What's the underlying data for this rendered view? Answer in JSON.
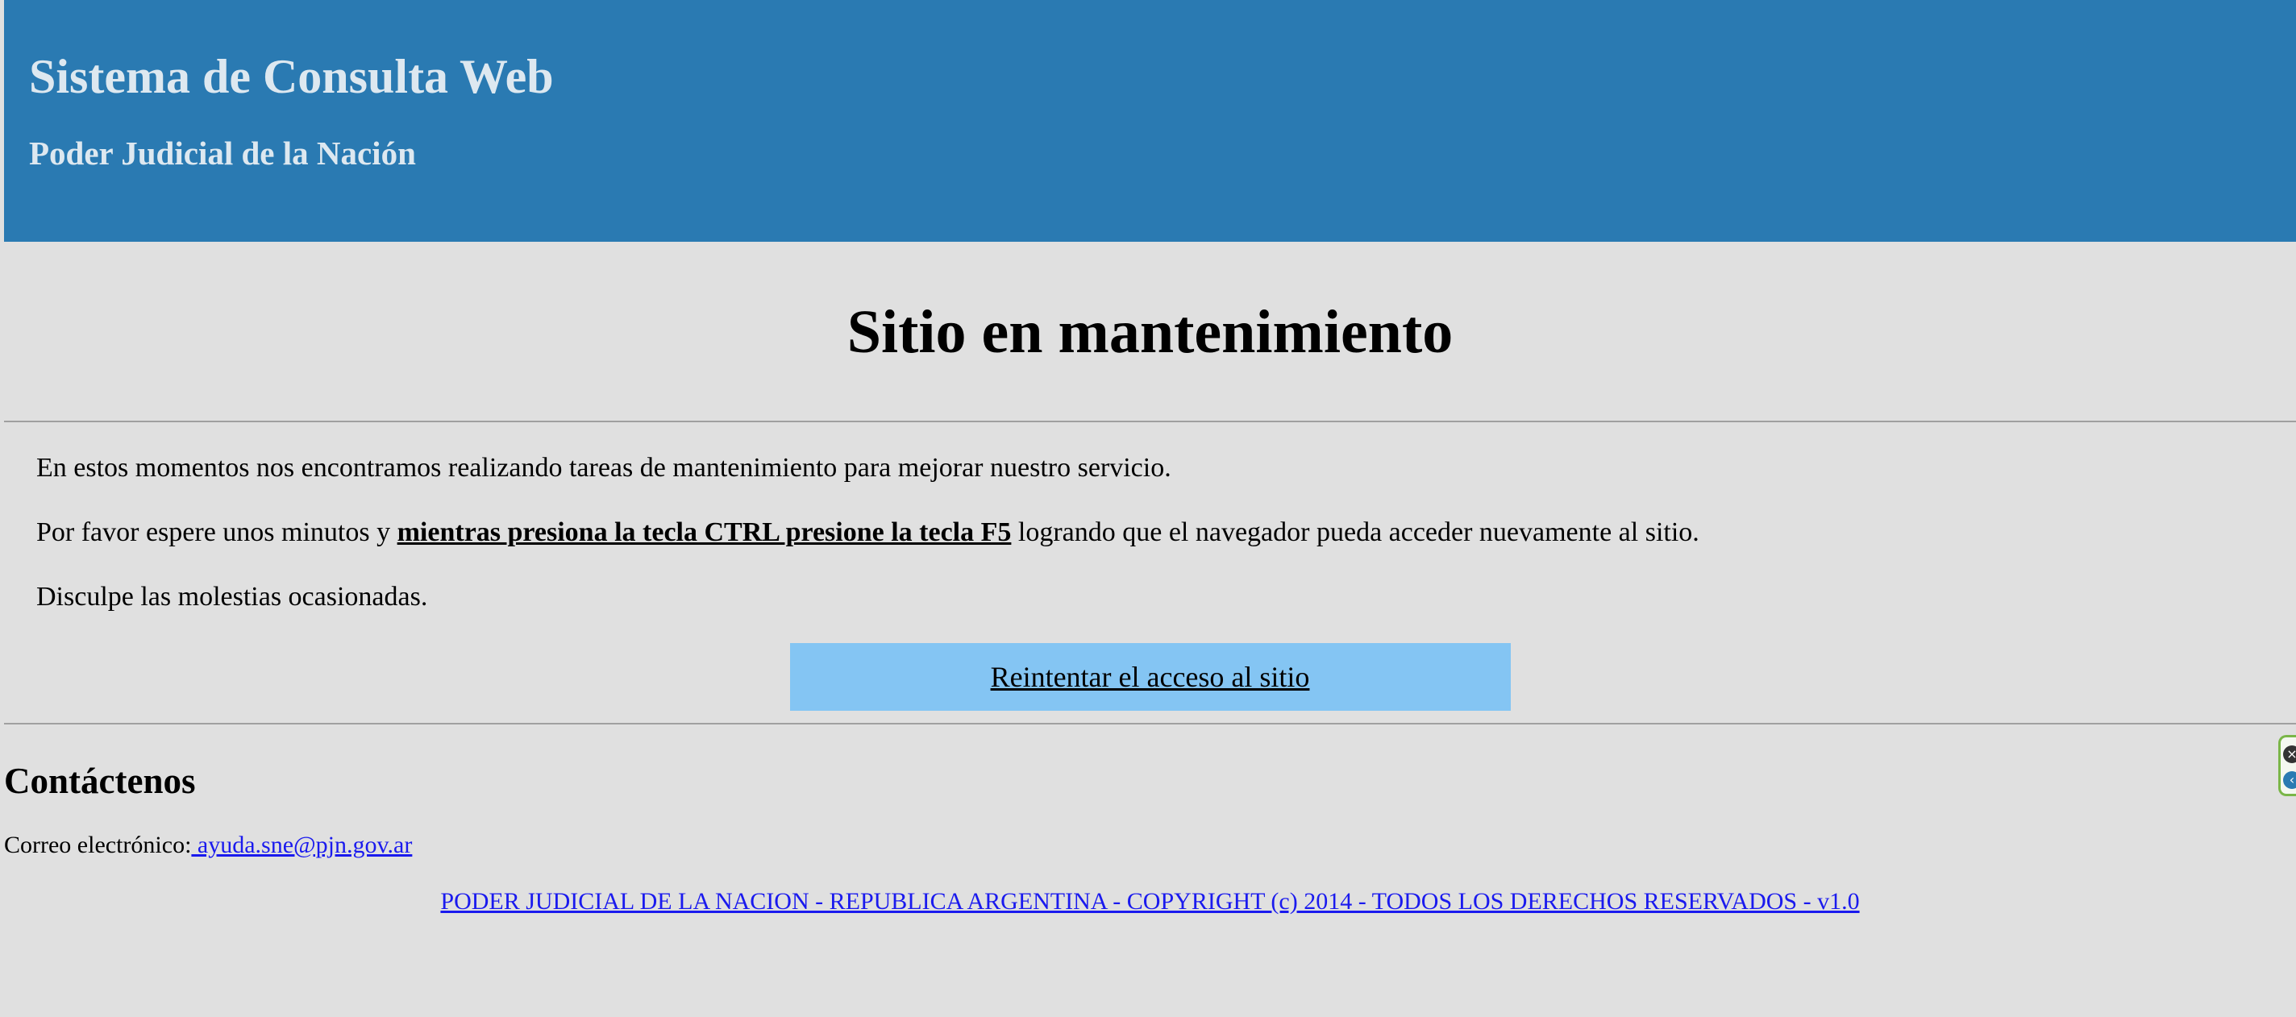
{
  "header": {
    "title": "Sistema de Consulta Web",
    "subtitle": "Poder Judicial de la Nación"
  },
  "main": {
    "title": "Sitio en mantenimiento",
    "paragraph1": "En estos momentos nos encontramos realizando tareas de mantenimiento para mejorar nuestro servicio.",
    "paragraph2_prefix": "Por favor espere unos minutos y ",
    "paragraph2_emphasis": "mientras presiona la tecla CTRL presione la tecla F5",
    "paragraph2_suffix": " logrando que el navegador pueda acceder nuevamente al sitio.",
    "paragraph3": "Disculpe las molestias ocasionadas.",
    "retry_label": "Reintentar el acceso al sitio"
  },
  "contact": {
    "title": "Contáctenos",
    "email_label": "Correo electrónico:",
    "email": " ayuda.sne@pjn.gov.ar"
  },
  "footer": {
    "copyright": "PODER JUDICIAL DE LA NACION - REPUBLICA ARGENTINA - COPYRIGHT (c) 2014 - TODOS LOS DERECHOS RESERVADOS - v1.0"
  },
  "edge_widget": {
    "close_icon": "close-icon",
    "expand_icon": "expand-icon"
  },
  "colors": {
    "header_bg": "#2a7ab2",
    "page_bg": "#e0e0e0",
    "button_bg": "#84c5f3",
    "link": "#1a1aee"
  }
}
